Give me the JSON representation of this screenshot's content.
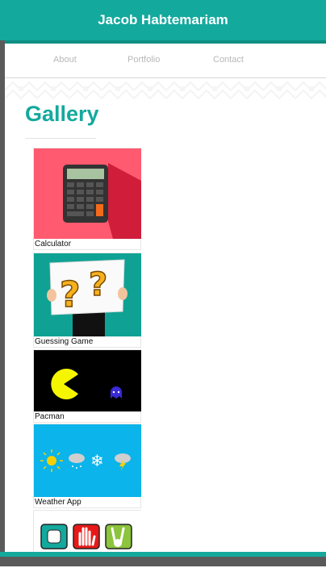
{
  "header": {
    "title": "Jacob Habtemariam"
  },
  "nav": {
    "about": "About",
    "portfolio": "Portfolio",
    "contact": "Contact"
  },
  "gallery": {
    "heading": "Gallery",
    "items": [
      {
        "caption": "Calculator"
      },
      {
        "caption": "Guessing Game"
      },
      {
        "caption": "Pacman"
      },
      {
        "caption": "Weather App"
      },
      {
        "caption": ""
      }
    ]
  },
  "colors": {
    "accent": "#14a99d",
    "calculator_bg": "#ff5a6f",
    "guess_bg": "#0fa294",
    "weather_bg": "#0bb4ea"
  }
}
